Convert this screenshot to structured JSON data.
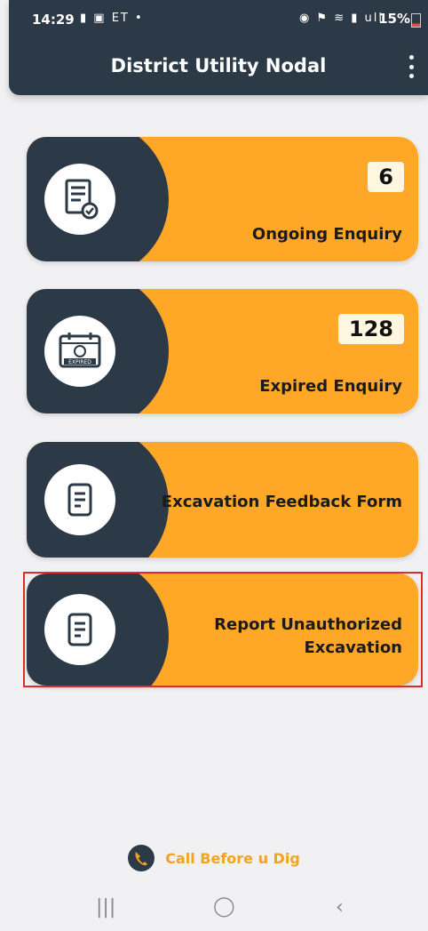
{
  "status_bar": {
    "time": "14:29",
    "left_icons": "▮ ▣ ET •",
    "right_icons": "◉ ⚑ ≋ ▮ ull",
    "battery": "15%"
  },
  "app_bar": {
    "title": "District Utility Nodal"
  },
  "cards": [
    {
      "label": "Ongoing Enquiry",
      "count": "6",
      "icon": "document-check-icon"
    },
    {
      "label": "Expired Enquiry",
      "count": "128",
      "icon": "calendar-expired-icon"
    },
    {
      "label": "Excavation Feedback Form",
      "icon": "form-icon"
    },
    {
      "label_line1": "Report Unauthorized",
      "label_line2": "Excavation",
      "icon": "form-icon"
    }
  ],
  "footer": {
    "brand_text": "Call Before u Dig"
  },
  "colors": {
    "accent": "#ffa726",
    "dark": "#2c3a48",
    "highlight": "#e12a2a"
  }
}
